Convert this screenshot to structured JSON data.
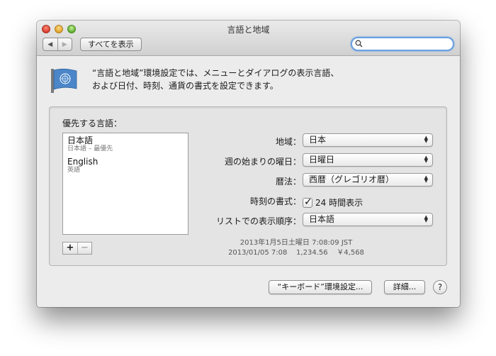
{
  "window": {
    "title": "言語と地域"
  },
  "toolbar": {
    "back_icon": "◀",
    "forward_icon": "▶",
    "show_all": "すべてを表示",
    "search_value": ""
  },
  "header": {
    "line1": "“言語と地域”環境設定では、メニューとダイアログの表示言語、",
    "line2": "および日付、時刻、通貨の書式を設定できます。"
  },
  "languages": {
    "title": "優先する言語：",
    "items": [
      {
        "name": "日本語",
        "sub": "日本語 – 最優先"
      },
      {
        "name": "English",
        "sub": "英語"
      }
    ],
    "add": "+",
    "remove": "−"
  },
  "settings": {
    "region_label": "地域：",
    "region_value": "日本",
    "week_label": "週の始まりの曜日：",
    "week_value": "日曜日",
    "calendar_label": "暦法：",
    "calendar_value": "西暦（グレゴリオ暦）",
    "time_label": "時刻の書式：",
    "time_checkbox": "24 時間表示",
    "time_checked": true,
    "order_label": "リストでの表示順序：",
    "order_value": "日本語"
  },
  "samples": {
    "line1": "2013年1月5日土曜日 7:08:09 JST",
    "line2": "2013/01/05 7:08    1,234.56    ￥4,568"
  },
  "buttons": {
    "keyboard": "“キーボード”環境設定...",
    "advanced": "詳細...",
    "help": "?"
  },
  "colors": {
    "accent": "#6aa0e0",
    "flag_blue": "#4a86c8"
  }
}
